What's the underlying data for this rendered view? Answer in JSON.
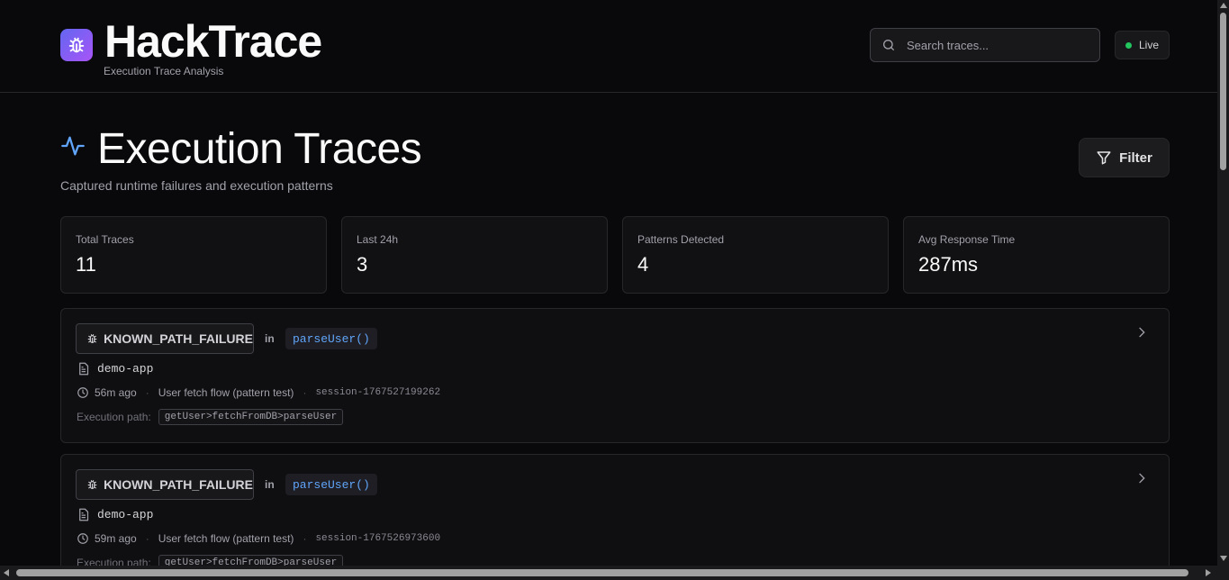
{
  "header": {
    "brand_title": "HackTrace",
    "brand_subtitle": "Execution Trace Analysis",
    "search_placeholder": "Search traces...",
    "live_label": "Live"
  },
  "page": {
    "title": "Execution Traces",
    "subtitle": "Captured runtime failures and execution patterns",
    "filter_label": "Filter"
  },
  "stats": [
    {
      "label": "Total Traces",
      "value": "11"
    },
    {
      "label": "Last 24h",
      "value": "3"
    },
    {
      "label": "Patterns Detected",
      "value": "4"
    },
    {
      "label": "Avg Response Time",
      "value": "287ms"
    }
  ],
  "traces": [
    {
      "type": "KNOWN_PATH_FAILURE",
      "in_word": "in",
      "function": "parseUser()",
      "app": "demo-app",
      "time": "56m ago",
      "flow": "User fetch flow (pattern test)",
      "session": "session-1767527199262",
      "path_label": "Execution path:",
      "path": "getUser>fetchFromDB>parseUser"
    },
    {
      "type": "KNOWN_PATH_FAILURE",
      "in_word": "in",
      "function": "parseUser()",
      "app": "demo-app",
      "time": "59m ago",
      "flow": "User fetch flow (pattern test)",
      "session": "session-1767526973600",
      "path_label": "Execution path:",
      "path": "getUser>fetchFromDB>parseUser"
    }
  ],
  "colors": {
    "accent": "#60a5fa",
    "live": "#22c55e",
    "logo_start": "#6366f1",
    "logo_end": "#a855f7"
  }
}
